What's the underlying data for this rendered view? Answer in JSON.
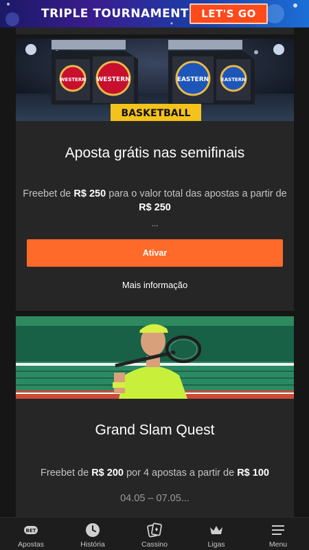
{
  "banner": {
    "title": "TRIPLE TOURNAMENT",
    "cta": "LET'S GO",
    "bg_start": "#1b1a66",
    "bg_end": "#1c6fd6",
    "cta_color": "#ff4a1c"
  },
  "offers": [
    {
      "image_badge": "BASKETBALL",
      "image_logos": [
        "WESTERN",
        "WESTERN",
        "EASTERN",
        "EASTERN"
      ],
      "title": "Aposta grátis nas semifinais",
      "desc_part1": "Freebet de ",
      "amount1": "R$ 250",
      "desc_part2": " para o valor total das apostas a partir de ",
      "amount2": "R$ 250",
      "ellipsis": "...",
      "cta": "Ativar",
      "more": "Mais informação"
    },
    {
      "title": "Grand Slam Quest",
      "desc_part1": "Freebet de ",
      "amount1": "R$ 200",
      "desc_part2": " por 4 apostas a partir de ",
      "amount2": "R$ 100",
      "dates": "04.05 – 07.05..."
    }
  ],
  "nav": [
    {
      "label": "Apostas",
      "icon": "bet-icon",
      "badge": "BET"
    },
    {
      "label": "História",
      "icon": "clock-icon"
    },
    {
      "label": "Cassino",
      "icon": "cards-icon"
    },
    {
      "label": "Ligas",
      "icon": "crown-icon"
    },
    {
      "label": "Menu",
      "icon": "hamburger-icon"
    }
  ],
  "colors": {
    "accent": "#fd6a2a",
    "card_bg": "#262626",
    "page_bg": "#161616",
    "nav_bg": "#1d1d1d"
  }
}
